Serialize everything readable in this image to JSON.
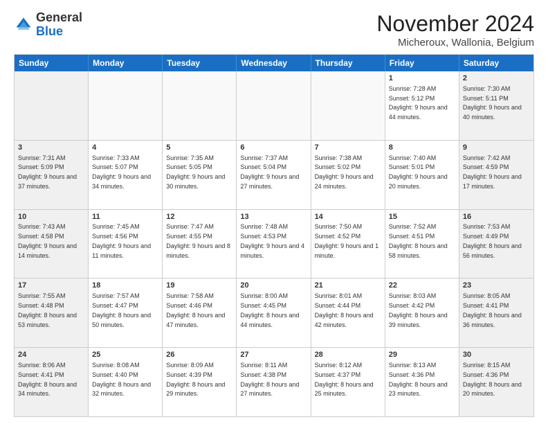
{
  "logo": {
    "general": "General",
    "blue": "Blue"
  },
  "header": {
    "month": "November 2024",
    "location": "Micheroux, Wallonia, Belgium"
  },
  "days": [
    "Sunday",
    "Monday",
    "Tuesday",
    "Wednesday",
    "Thursday",
    "Friday",
    "Saturday"
  ],
  "rows": [
    [
      {
        "day": "",
        "info": ""
      },
      {
        "day": "",
        "info": ""
      },
      {
        "day": "",
        "info": ""
      },
      {
        "day": "",
        "info": ""
      },
      {
        "day": "",
        "info": ""
      },
      {
        "day": "1",
        "info": "Sunrise: 7:28 AM\nSunset: 5:12 PM\nDaylight: 9 hours and 44 minutes."
      },
      {
        "day": "2",
        "info": "Sunrise: 7:30 AM\nSunset: 5:11 PM\nDaylight: 9 hours and 40 minutes."
      }
    ],
    [
      {
        "day": "3",
        "info": "Sunrise: 7:31 AM\nSunset: 5:09 PM\nDaylight: 9 hours and 37 minutes."
      },
      {
        "day": "4",
        "info": "Sunrise: 7:33 AM\nSunset: 5:07 PM\nDaylight: 9 hours and 34 minutes."
      },
      {
        "day": "5",
        "info": "Sunrise: 7:35 AM\nSunset: 5:05 PM\nDaylight: 9 hours and 30 minutes."
      },
      {
        "day": "6",
        "info": "Sunrise: 7:37 AM\nSunset: 5:04 PM\nDaylight: 9 hours and 27 minutes."
      },
      {
        "day": "7",
        "info": "Sunrise: 7:38 AM\nSunset: 5:02 PM\nDaylight: 9 hours and 24 minutes."
      },
      {
        "day": "8",
        "info": "Sunrise: 7:40 AM\nSunset: 5:01 PM\nDaylight: 9 hours and 20 minutes."
      },
      {
        "day": "9",
        "info": "Sunrise: 7:42 AM\nSunset: 4:59 PM\nDaylight: 9 hours and 17 minutes."
      }
    ],
    [
      {
        "day": "10",
        "info": "Sunrise: 7:43 AM\nSunset: 4:58 PM\nDaylight: 9 hours and 14 minutes."
      },
      {
        "day": "11",
        "info": "Sunrise: 7:45 AM\nSunset: 4:56 PM\nDaylight: 9 hours and 11 minutes."
      },
      {
        "day": "12",
        "info": "Sunrise: 7:47 AM\nSunset: 4:55 PM\nDaylight: 9 hours and 8 minutes."
      },
      {
        "day": "13",
        "info": "Sunrise: 7:48 AM\nSunset: 4:53 PM\nDaylight: 9 hours and 4 minutes."
      },
      {
        "day": "14",
        "info": "Sunrise: 7:50 AM\nSunset: 4:52 PM\nDaylight: 9 hours and 1 minute."
      },
      {
        "day": "15",
        "info": "Sunrise: 7:52 AM\nSunset: 4:51 PM\nDaylight: 8 hours and 58 minutes."
      },
      {
        "day": "16",
        "info": "Sunrise: 7:53 AM\nSunset: 4:49 PM\nDaylight: 8 hours and 56 minutes."
      }
    ],
    [
      {
        "day": "17",
        "info": "Sunrise: 7:55 AM\nSunset: 4:48 PM\nDaylight: 8 hours and 53 minutes."
      },
      {
        "day": "18",
        "info": "Sunrise: 7:57 AM\nSunset: 4:47 PM\nDaylight: 8 hours and 50 minutes."
      },
      {
        "day": "19",
        "info": "Sunrise: 7:58 AM\nSunset: 4:46 PM\nDaylight: 8 hours and 47 minutes."
      },
      {
        "day": "20",
        "info": "Sunrise: 8:00 AM\nSunset: 4:45 PM\nDaylight: 8 hours and 44 minutes."
      },
      {
        "day": "21",
        "info": "Sunrise: 8:01 AM\nSunset: 4:44 PM\nDaylight: 8 hours and 42 minutes."
      },
      {
        "day": "22",
        "info": "Sunrise: 8:03 AM\nSunset: 4:42 PM\nDaylight: 8 hours and 39 minutes."
      },
      {
        "day": "23",
        "info": "Sunrise: 8:05 AM\nSunset: 4:41 PM\nDaylight: 8 hours and 36 minutes."
      }
    ],
    [
      {
        "day": "24",
        "info": "Sunrise: 8:06 AM\nSunset: 4:41 PM\nDaylight: 8 hours and 34 minutes."
      },
      {
        "day": "25",
        "info": "Sunrise: 8:08 AM\nSunset: 4:40 PM\nDaylight: 8 hours and 32 minutes."
      },
      {
        "day": "26",
        "info": "Sunrise: 8:09 AM\nSunset: 4:39 PM\nDaylight: 8 hours and 29 minutes."
      },
      {
        "day": "27",
        "info": "Sunrise: 8:11 AM\nSunset: 4:38 PM\nDaylight: 8 hours and 27 minutes."
      },
      {
        "day": "28",
        "info": "Sunrise: 8:12 AM\nSunset: 4:37 PM\nDaylight: 8 hours and 25 minutes."
      },
      {
        "day": "29",
        "info": "Sunrise: 8:13 AM\nSunset: 4:36 PM\nDaylight: 8 hours and 23 minutes."
      },
      {
        "day": "30",
        "info": "Sunrise: 8:15 AM\nSunset: 4:36 PM\nDaylight: 8 hours and 20 minutes."
      }
    ]
  ]
}
